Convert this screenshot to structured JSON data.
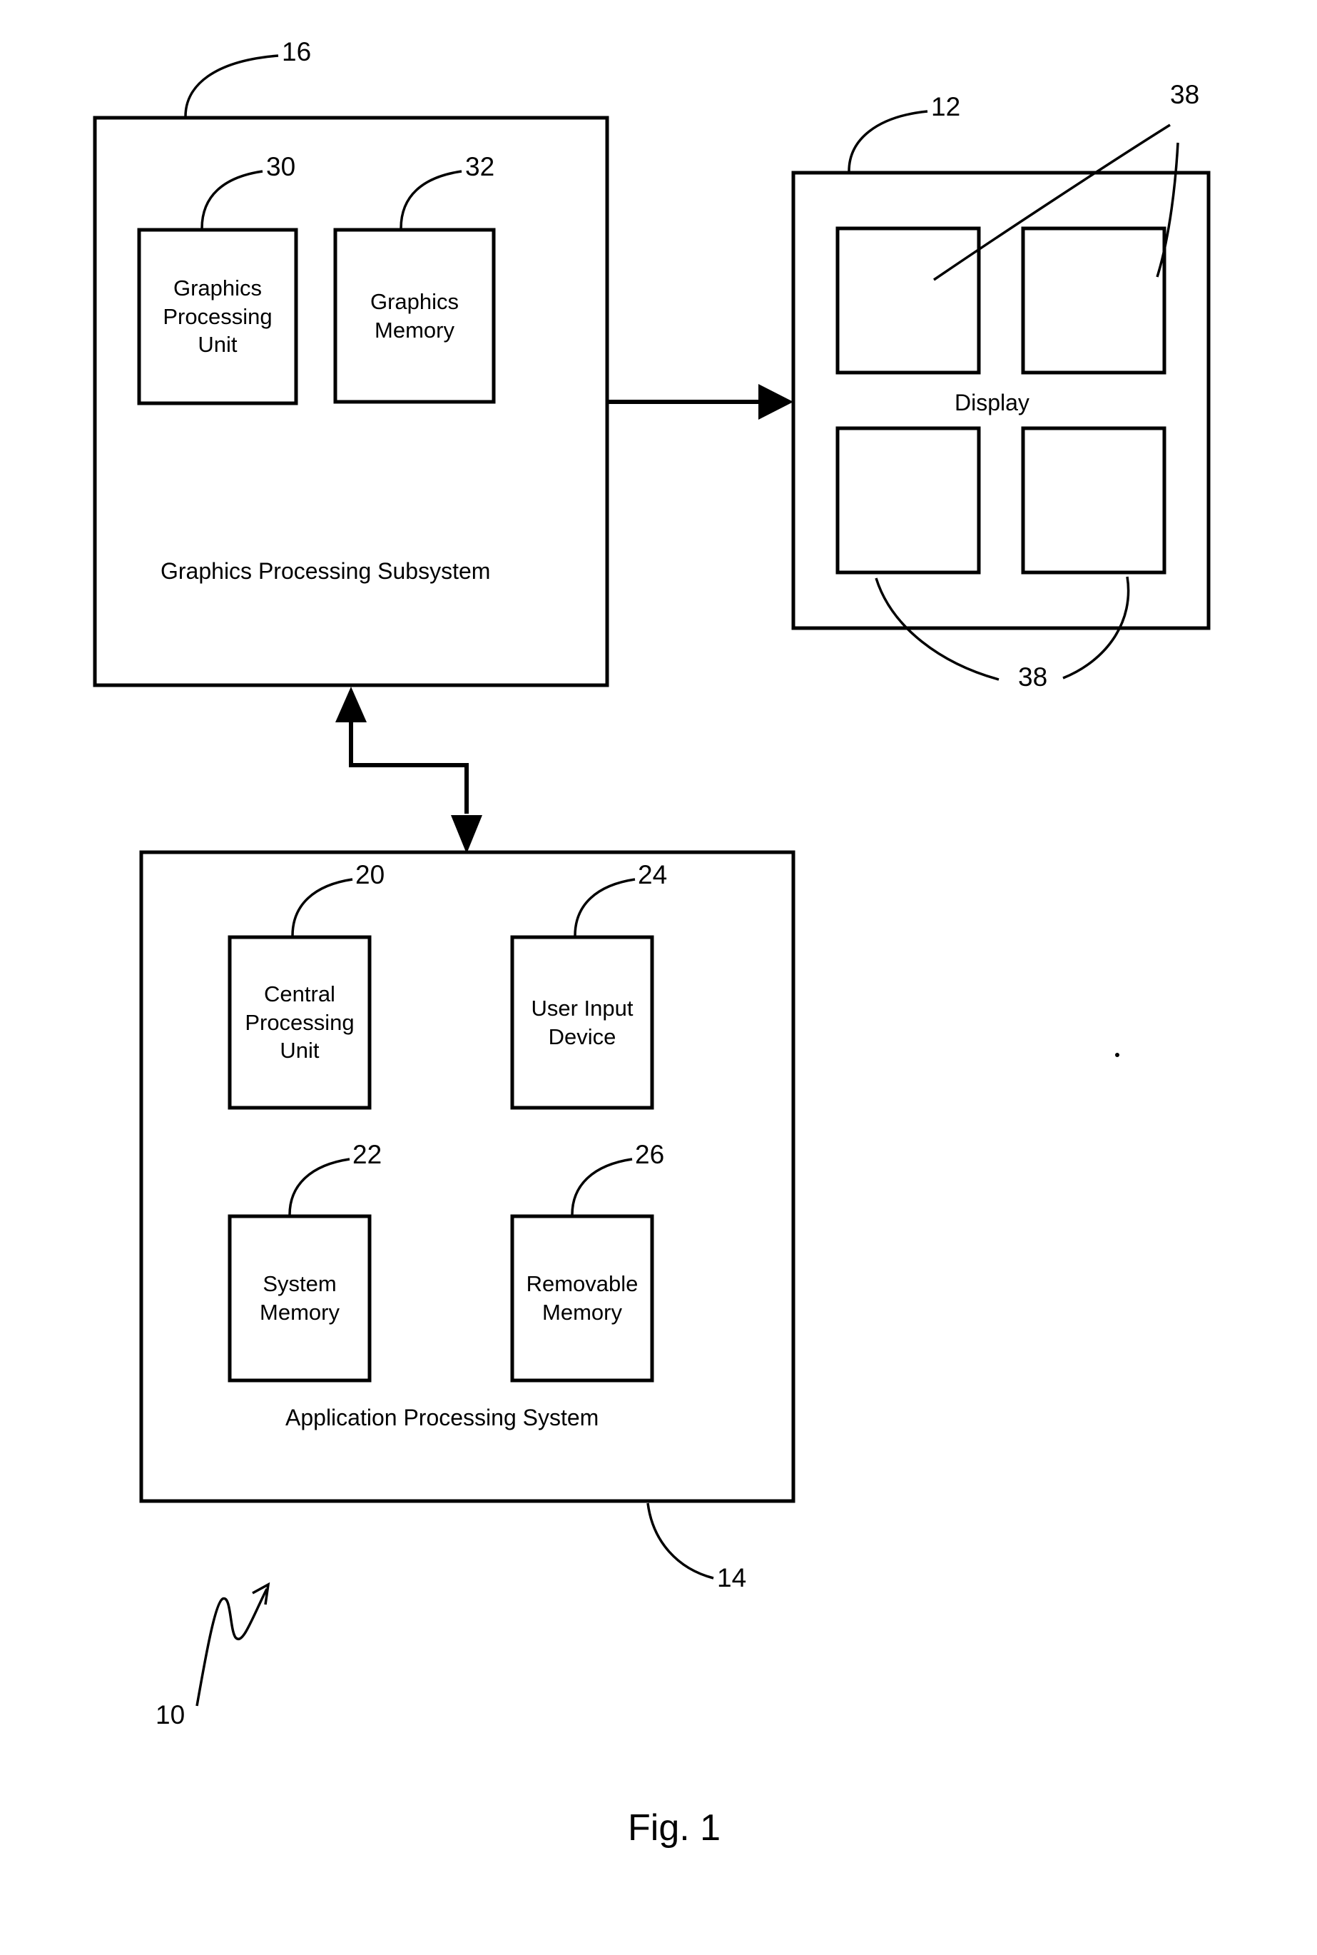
{
  "figure": {
    "caption": "Fig. 1",
    "system_ref": "10"
  },
  "graphics_subsystem": {
    "ref": "16",
    "caption": "Graphics Processing Subsystem",
    "blocks": [
      {
        "ref": "30",
        "label": "Graphics\nProcessing\nUnit"
      },
      {
        "ref": "32",
        "label": "Graphics\nMemory"
      }
    ]
  },
  "display": {
    "ref": "12",
    "caption": "Display",
    "region_ref_top": "38",
    "region_ref_bottom": "38",
    "regions": [
      {
        "name": "top-left-region"
      },
      {
        "name": "top-right-region"
      },
      {
        "name": "bottom-left-region"
      },
      {
        "name": "bottom-right-region"
      }
    ]
  },
  "application_system": {
    "ref": "14",
    "caption": "Application Processing System",
    "blocks": [
      {
        "ref": "20",
        "label": "Central\nProcessing\nUnit"
      },
      {
        "ref": "24",
        "label": "User Input\nDevice"
      },
      {
        "ref": "22",
        "label": "System\nMemory"
      },
      {
        "ref": "26",
        "label": "Removable\nMemory"
      }
    ]
  },
  "connectors": {
    "graphics_to_display": "one-way arrow",
    "graphics_to_application": "two-way z-shaped arrow"
  },
  "colors": {
    "stroke": "#000000",
    "background": "#ffffff"
  }
}
